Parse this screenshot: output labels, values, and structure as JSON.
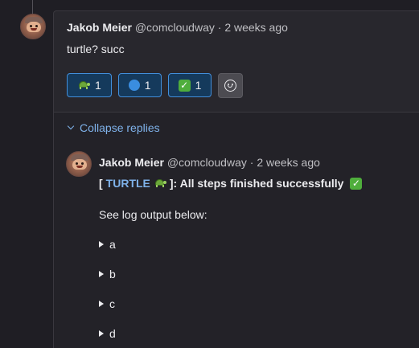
{
  "note": {
    "author_name": "Jakob Meier",
    "author_handle": "@comcloudway",
    "separator": "·",
    "time_ago": "2 weeks ago",
    "body": "turtle? succ",
    "reactions": [
      {
        "emoji": "turtle",
        "count": "1"
      },
      {
        "emoji": "blue-circle",
        "count": "1"
      },
      {
        "emoji": "check-mark",
        "count": "1"
      }
    ]
  },
  "replies": {
    "collapse_label": "Collapse replies",
    "reply": {
      "author_name": "Jakob Meier",
      "author_handle": "@comcloudway",
      "separator": "·",
      "time_ago": "2 weeks ago",
      "title_prefix": "[",
      "title_link": "TURTLE",
      "title_suffix": "]: All steps finished successfully",
      "log_intro": "See log output below:",
      "details": [
        "a",
        "b",
        "c",
        "d"
      ]
    }
  },
  "colors": {
    "accent": "#428fdc",
    "link": "#7fb2ea",
    "background": "#1f1e24",
    "card": "#28272d"
  }
}
